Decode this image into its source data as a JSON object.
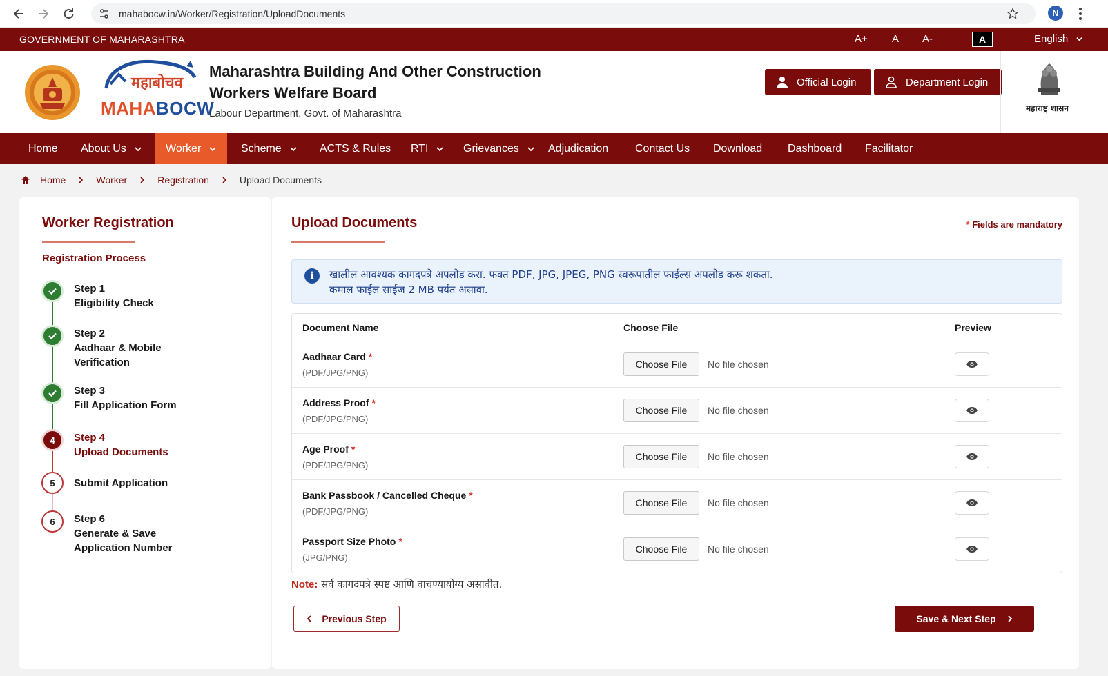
{
  "browser": {
    "url": "mahabocw.in/Worker/Registration/UploadDocuments",
    "profile_initial": "N"
  },
  "gov_bar": {
    "title": "GOVERNMENT OF MAHARASHTRA",
    "font_increase": "A+",
    "font_normal": "A",
    "font_decrease": "A-",
    "contrast": "A",
    "language": "English"
  },
  "header": {
    "logo_hindi": "महाबोचव",
    "logo_en_part1": "MAHA",
    "logo_en_part2": "BOCW",
    "board_title": "Maharashtra Building And Other Construction Workers Welfare Board",
    "board_subtitle": "Labour Department, Govt. of Maharashtra",
    "official_login": "Official Login",
    "department_login": "Department Login",
    "emblem_label": "महाराष्ट्र शासन"
  },
  "nav": {
    "items": [
      {
        "label": "Home"
      },
      {
        "label": "About Us"
      },
      {
        "label": "Worker"
      },
      {
        "label": "Scheme"
      },
      {
        "label": "ACTS & Rules"
      },
      {
        "label": "RTI"
      },
      {
        "label": "Grievances"
      },
      {
        "label": "Adjudication"
      },
      {
        "label": "Contact Us"
      },
      {
        "label": "Download"
      },
      {
        "label": "Dashboard"
      },
      {
        "label": "Facilitator"
      }
    ]
  },
  "breadcrumb": [
    "Home",
    "Worker",
    "Registration",
    "Upload Documents"
  ],
  "sidebar": {
    "title": "Worker Registration",
    "process_label": "Registration Process",
    "steps": [
      {
        "line1": "Step 1",
        "line2": "Eligibility Check",
        "line3": "",
        "status": "done"
      },
      {
        "line1": "Step 2",
        "line2": "Aadhaar & Mobile",
        "line3": "Verification",
        "status": "done"
      },
      {
        "line1": "Step 3",
        "line2": "Fill Application Form",
        "line3": "",
        "status": "done"
      },
      {
        "number": "4",
        "line1": "Step 4",
        "line2": "Upload Documents",
        "line3": "",
        "status": "active"
      },
      {
        "number": "5",
        "line1": "Submit Application",
        "line2": "",
        "line3": "",
        "status": "todo"
      },
      {
        "number": "6",
        "line1": "Step 6",
        "line2": "Generate & Save",
        "line3": "Application Number",
        "status": "todo"
      }
    ]
  },
  "main": {
    "title": "Upload Documents",
    "mandatory_star": "*",
    "mandatory_text": "Fields are mandatory",
    "info_line1": "खालील आवश्यक कागदपत्रे अपलोड करा. फक्त PDF, JPG, JPEG, PNG स्वरूपातील फाईल्स अपलोड करू शकता.",
    "info_line2": "कमाल फाईल साईज 2 MB पर्यंत असावा.",
    "columns": [
      "Document Name",
      "Choose File",
      "Preview"
    ],
    "documents": [
      {
        "name": "Aadhaar Card",
        "required": "*",
        "formats": "(PDF/JPG/PNG)",
        "button": "Choose File",
        "status": "No file chosen"
      },
      {
        "name": "Address Proof",
        "required": "*",
        "formats": "(PDF/JPG/PNG)",
        "button": "Choose File",
        "status": "No file chosen"
      },
      {
        "name": "Age Proof",
        "required": "*",
        "formats": "(PDF/JPG/PNG)",
        "button": "Choose File",
        "status": "No file chosen"
      },
      {
        "name": "Bank Passbook / Cancelled Cheque",
        "required": "*",
        "formats": "(PDF/JPG/PNG)",
        "button": "Choose File",
        "status": "No file chosen"
      },
      {
        "name": "Passport Size Photo",
        "required": "*",
        "formats": "(JPG/PNG)",
        "button": "Choose File",
        "status": "No file chosen"
      }
    ],
    "note_label": "Note:",
    "note_text": "सर्व कागदपत्रे स्पष्ट आणि वाचण्यायोग्य असावीत.",
    "previous_button": "Previous Step",
    "next_button": "Save & Next Step"
  },
  "colors": {
    "brand_maroon": "#7b0c0c",
    "active_orange": "#e85a2a",
    "done_green": "#2f7d32",
    "info_blue": "#1f4e9c"
  }
}
